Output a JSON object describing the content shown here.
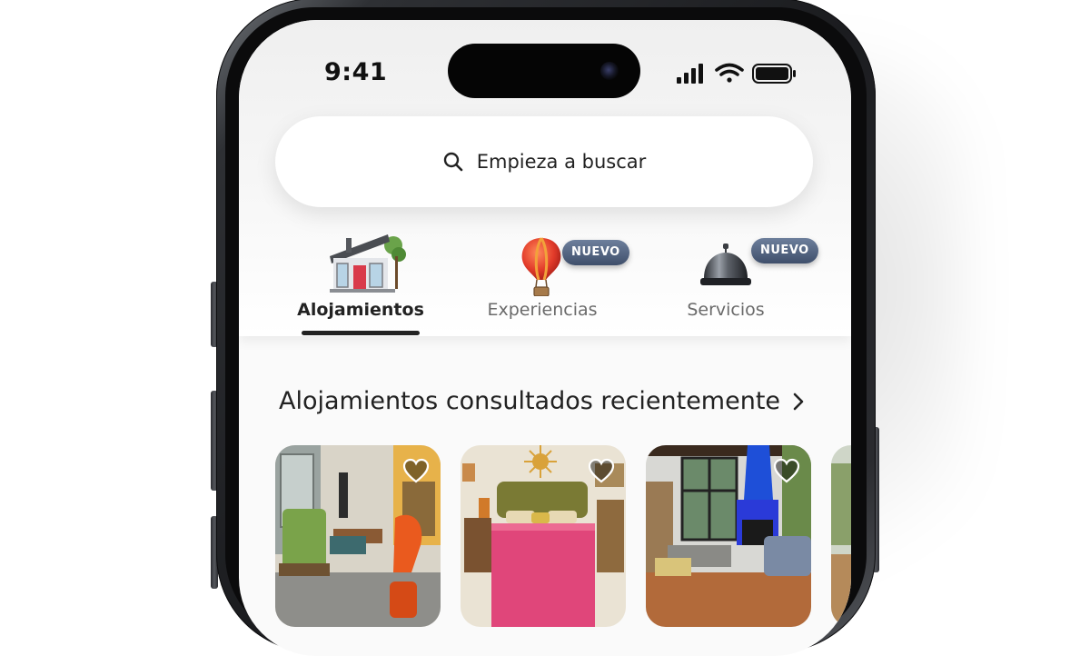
{
  "status_bar": {
    "time": "9:41",
    "signal_icon": "cellular-signal-icon",
    "wifi_icon": "wifi-icon",
    "battery_icon": "battery-icon"
  },
  "search": {
    "label": "Empieza a buscar",
    "icon": "search-icon"
  },
  "tabs": [
    {
      "label": "Alojamientos",
      "icon": "house-icon",
      "active": true,
      "badge": ""
    },
    {
      "label": "Experiencias",
      "icon": "hot-air-balloon-icon",
      "active": false,
      "badge": "NUEVO"
    },
    {
      "label": "Servicios",
      "icon": "service-bell-icon",
      "active": false,
      "badge": "NUEVO"
    }
  ],
  "recent": {
    "title": "Alojamientos consultados recientemente",
    "chevron_icon": "chevron-right-icon",
    "listings": [
      {
        "image": "living-room-orange-chair-photo",
        "favorite_icon": "heart-icon"
      },
      {
        "image": "bedroom-pink-bed-photo",
        "favorite_icon": "heart-icon"
      },
      {
        "image": "loft-blue-fireplace-photo",
        "favorite_icon": "heart-icon"
      }
    ]
  },
  "colors": {
    "badge": "#4e5f7c",
    "active_tab": "#222222",
    "background": "#ffffff"
  }
}
